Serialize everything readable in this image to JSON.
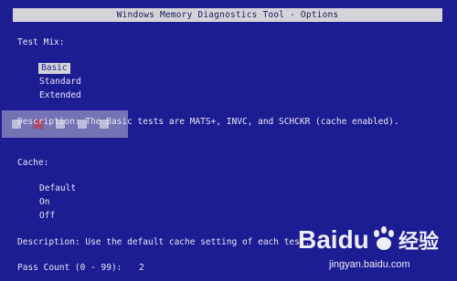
{
  "window": {
    "title": "Windows Memory Diagnostics Tool - Options"
  },
  "test_mix": {
    "label": "Test Mix:",
    "options": [
      "Basic",
      "Standard",
      "Extended"
    ],
    "selected": "Basic",
    "description": "Description: The Basic tests are MATS+, INVC, and SCHCKR (cache enabled)."
  },
  "cache": {
    "label": "Cache:",
    "options": [
      "Default",
      "On",
      "Off"
    ],
    "description": "Description: Use the default cache setting of each test."
  },
  "pass_count": {
    "label": "Pass Count (0 - 99):",
    "value": "2"
  },
  "watermark": {
    "logo_text": "Baidu",
    "logo_cn": "经验",
    "url": "jingyan.baidu.com"
  }
}
